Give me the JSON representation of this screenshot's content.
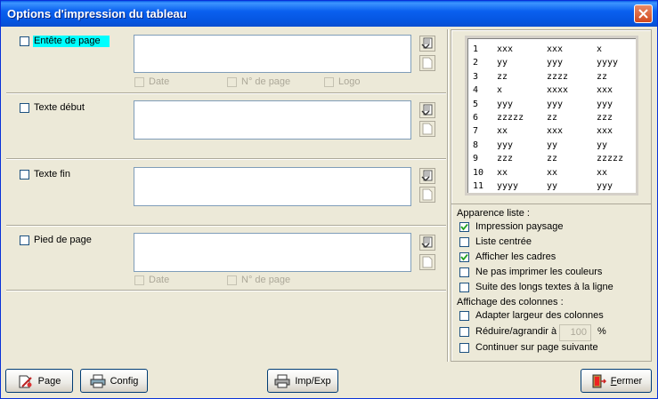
{
  "window": {
    "title": "Options d'impression du tableau",
    "close_icon": "close-icon"
  },
  "sections": {
    "header": {
      "label": "Entête de page",
      "opt_date": "Date",
      "opt_page": "N° de page",
      "opt_logo": "Logo"
    },
    "start_text": {
      "label": "Texte début"
    },
    "end_text": {
      "label": "Texte fin"
    },
    "footer": {
      "label": "Pied de page",
      "opt_date": "Date",
      "opt_page": "N° de page"
    }
  },
  "preview": {
    "rows": [
      [
        "1",
        "xxx",
        "xxx",
        "x"
      ],
      [
        "2",
        "yy",
        "yyy",
        "yyyy"
      ],
      [
        "3",
        "zz",
        "zzzz",
        "zz"
      ],
      [
        "4",
        "x",
        "xxxx",
        "xxx"
      ],
      [
        "5",
        "yyy",
        "yyy",
        "yyy"
      ],
      [
        "6",
        "zzzzz",
        "zz",
        "zzz"
      ],
      [
        "7",
        "xx",
        "xxx",
        "xxx"
      ],
      [
        "8",
        "yyy",
        "yy",
        "yy"
      ],
      [
        "9",
        "zzz",
        "zz",
        "zzzzz"
      ],
      [
        "10",
        "xx",
        "xx",
        "xx"
      ],
      [
        "11",
        "yyyy",
        "yy",
        "yyy"
      ]
    ]
  },
  "appearance": {
    "title": "Apparence liste :",
    "items": [
      {
        "label": "Impression paysage",
        "checked": true
      },
      {
        "label": "Liste centrée",
        "checked": false
      },
      {
        "label": "Afficher les cadres",
        "checked": true
      },
      {
        "label": "Ne pas imprimer les couleurs",
        "checked": false
      },
      {
        "label": "Suite des longs textes à la ligne",
        "checked": false
      }
    ]
  },
  "columns": {
    "title": "Affichage des colonnes :",
    "adapt": "Adapter largeur des colonnes",
    "resize": "Réduire/agrandir à",
    "resize_value": "100",
    "resize_unit": "%",
    "continue": "Continuer sur page suivante"
  },
  "buttons": {
    "page": "Page",
    "config": "Config",
    "impexp": "Imp/Exp",
    "close_first": "F",
    "close_rest": "ermer"
  }
}
